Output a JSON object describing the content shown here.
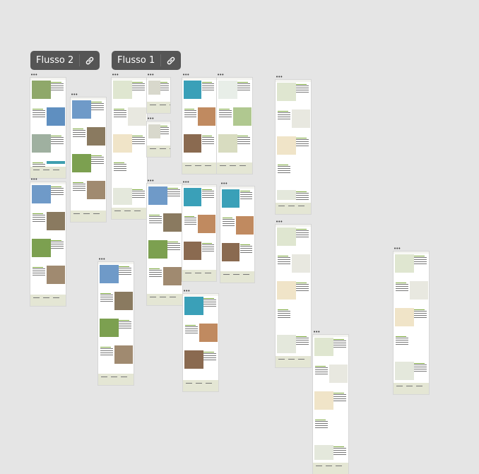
{
  "canvas": {
    "flows": [
      {
        "label": "Flusso 2",
        "icon": "link-icon"
      },
      {
        "label": "Flusso 1",
        "icon": "link-icon"
      }
    ],
    "frame_menu_label": "•••",
    "colors": {
      "canvas_bg": "#e5e5e5",
      "flow_tag_bg": "#555555",
      "accent_green": "#7aa63a",
      "footer_beige": "#e4e6d4"
    }
  }
}
